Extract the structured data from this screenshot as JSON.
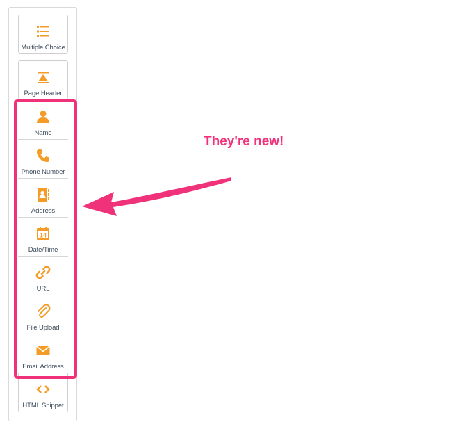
{
  "palette": {
    "icon_orange": "#f39c28",
    "highlight_pink": "#f0327a"
  },
  "fields": [
    {
      "label": "Multiple Choice",
      "icon": "list-icon"
    },
    {
      "label": "Page Header",
      "icon": "page-header-icon"
    },
    {
      "label": "Name",
      "icon": "person-icon"
    },
    {
      "label": "Phone Number",
      "icon": "phone-icon"
    },
    {
      "label": "Address",
      "icon": "address-book-icon"
    },
    {
      "label": "Date/Time",
      "icon": "calendar-icon"
    },
    {
      "label": "URL",
      "icon": "link-icon"
    },
    {
      "label": "File Upload",
      "icon": "paperclip-icon"
    },
    {
      "label": "Email Address",
      "icon": "envelope-icon"
    },
    {
      "label": "HTML Snippet",
      "icon": "code-brackets-icon"
    }
  ],
  "calendar_day": "14",
  "annotation": {
    "callout_text": "They're new!"
  }
}
